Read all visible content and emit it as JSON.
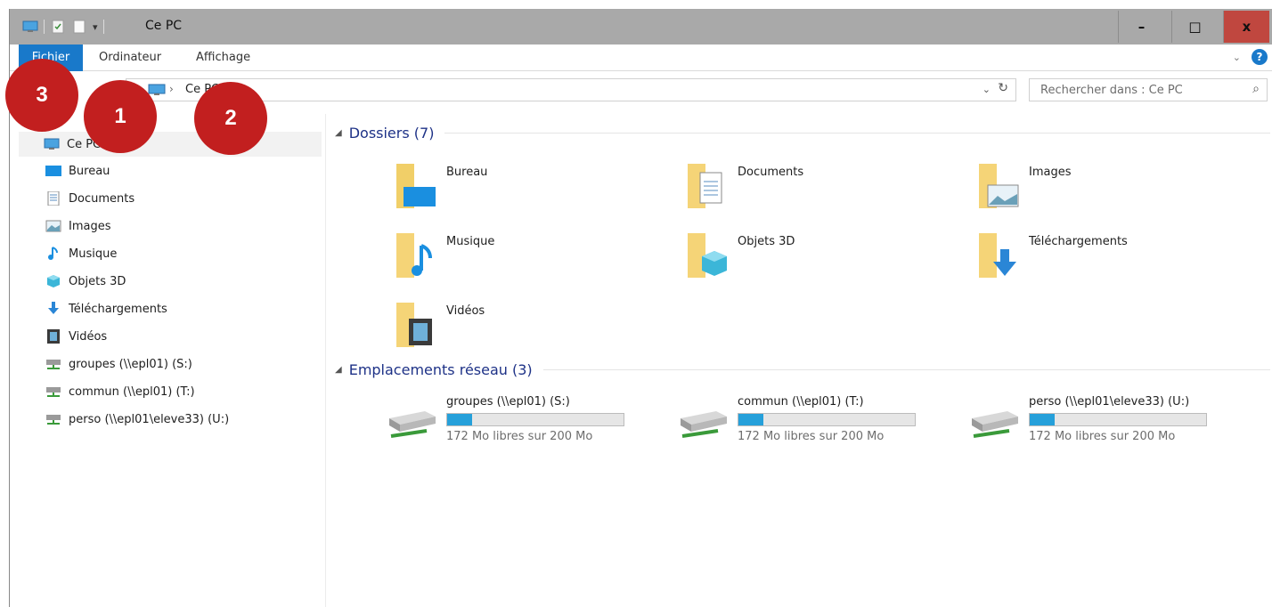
{
  "window": {
    "title": "Ce PC"
  },
  "ribbon": {
    "tabs": [
      "Fichier",
      "Ordinateur",
      "Affichage"
    ],
    "help": "?"
  },
  "address": {
    "crumb": "Ce PC",
    "separator": "›",
    "dropdown": "⌄",
    "refresh": "↻"
  },
  "search": {
    "placeholder": "Rechercher dans : Ce PC",
    "icon": "⌕"
  },
  "titlebar_buttons": {
    "min": "–",
    "max": "□",
    "close": "x"
  },
  "nav": {
    "root": "Ce PC",
    "items": [
      {
        "label": "Bureau",
        "icon": "desktop-icon"
      },
      {
        "label": "Documents",
        "icon": "documents-icon"
      },
      {
        "label": "Images",
        "icon": "images-icon"
      },
      {
        "label": "Musique",
        "icon": "music-icon"
      },
      {
        "label": "Objets 3D",
        "icon": "objects-3d-icon"
      },
      {
        "label": "Téléchargements",
        "icon": "downloads-icon"
      },
      {
        "label": "Vidéos",
        "icon": "videos-icon"
      },
      {
        "label": "groupes (\\\\epl01) (S:)",
        "icon": "network-drive-icon"
      },
      {
        "label": "commun (\\\\epl01) (T:)",
        "icon": "network-drive-icon"
      },
      {
        "label": "perso (\\\\epl01\\eleve33) (U:)",
        "icon": "network-drive-icon"
      }
    ]
  },
  "folders": {
    "header": "Dossiers (7)",
    "items": [
      "Bureau",
      "Documents",
      "Images",
      "Musique",
      "Objets 3D",
      "Téléchargements",
      "Vidéos"
    ]
  },
  "network": {
    "header": "Emplacements réseau (3)",
    "items": [
      {
        "name": "groupes (\\\\epl01) (S:)",
        "free": "172 Mo libres sur 200 Mo",
        "used_fraction": 0.14
      },
      {
        "name": "commun (\\\\epl01) (T:)",
        "free": "172 Mo libres sur 200 Mo",
        "used_fraction": 0.14
      },
      {
        "name": "perso (\\\\epl01\\eleve33) (U:)",
        "free": "172 Mo libres sur 200 Mo",
        "used_fraction": 0.14
      }
    ]
  },
  "badges": [
    "3",
    "1",
    "2"
  ],
  "colors": {
    "accent": "#1979ca",
    "badge": "#c21f1f",
    "close": "#c0473f",
    "bar_fill": "#26a0da"
  }
}
